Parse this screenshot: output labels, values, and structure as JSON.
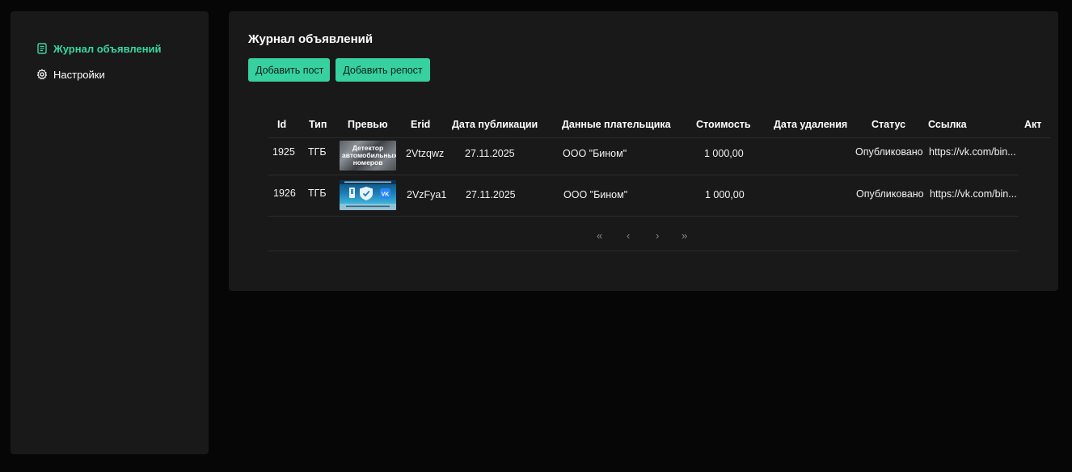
{
  "sidebar": {
    "items": [
      {
        "label": "Журнал объявлений",
        "icon": "journal-icon",
        "active": true
      },
      {
        "label": "Настройки",
        "icon": "gear-icon",
        "active": false
      }
    ]
  },
  "main": {
    "title": "Журнал объявлений",
    "buttons": {
      "add_post": "Добавить пост",
      "add_repost": "Добавить репост"
    },
    "table": {
      "columns": [
        "Id",
        "Тип",
        "Превью",
        "Erid",
        "Дата публикации",
        "Данные плательщика",
        "Стоимость",
        "Дата удаления",
        "Статус",
        "Ссылка",
        "Акт"
      ],
      "rows": [
        {
          "id": "1925",
          "type": "ТГБ",
          "preview_text": "Детектор автомобильных номеров",
          "erid": "2Vtzqwz",
          "published": "27.11.2025",
          "payer": "ООО \"Бином\"",
          "cost": "1 000,00",
          "deleted": "",
          "status": "Опубликовано",
          "link": "https://vk.com/bin...",
          "act": ""
        },
        {
          "id": "1926",
          "type": "ТГБ",
          "preview_text": "",
          "erid": "2VzFya1",
          "published": "27.11.2025",
          "payer": "ООО \"Бином\"",
          "cost": "1 000,00",
          "deleted": "",
          "status": "Опубликовано",
          "link": "https://vk.com/bin...",
          "act": ""
        }
      ]
    },
    "pagination": {
      "first": "«",
      "prev": "‹",
      "next": "›",
      "last": "»"
    }
  },
  "colors": {
    "accent": "#36d19e",
    "active_nav": "#3ad6a3",
    "panel": "#19191a",
    "background": "#060606"
  }
}
